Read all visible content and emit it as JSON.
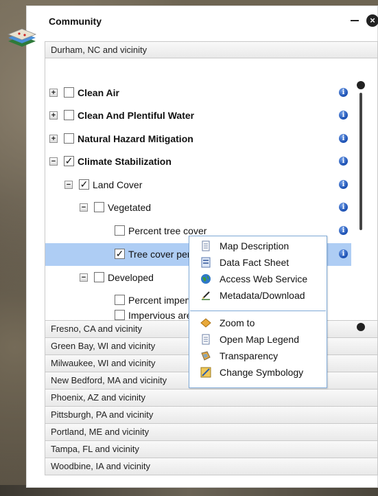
{
  "panel": {
    "title": "Community",
    "minimize_label": "_",
    "close_label": "×"
  },
  "communities": {
    "expanded": "Durham, NC and vicinity",
    "others": [
      "Fresno, CA and vicinity",
      "Green Bay, WI and vicinity",
      "Milwaukee, WI and vicinity",
      "New Bedford, MA and vicinity",
      "Phoenix, AZ and vicinity",
      "Pittsburgh, PA and vicinity",
      "Portland, ME and vicinity",
      "Tampa, FL and vicinity",
      "Woodbine, IA and vicinity"
    ]
  },
  "tree": [
    {
      "label": "Clean Air",
      "bold": true,
      "toggle": "+",
      "checked": false
    },
    {
      "label": "Clean And Plentiful Water",
      "bold": true,
      "toggle": "+",
      "checked": false
    },
    {
      "label": "Natural Hazard Mitigation",
      "bold": true,
      "toggle": "+",
      "checked": false
    },
    {
      "label": "Climate Stabilization",
      "bold": true,
      "toggle": "−",
      "checked": true
    },
    {
      "label": "Land Cover",
      "bold": false,
      "toggle": "−",
      "checked": true
    },
    {
      "label": "Vegetated",
      "bold": false,
      "toggle": "−",
      "checked": false
    },
    {
      "label": "Percent tree cover",
      "bold": false,
      "toggle": "",
      "checked": false
    },
    {
      "label": "Tree cover per capita (m2/person)",
      "bold": false,
      "toggle": "",
      "checked": true,
      "selected": true
    },
    {
      "label": "Developed",
      "bold": false,
      "toggle": "−",
      "checked": false
    },
    {
      "label": "Percent impervious",
      "bold": false,
      "toggle": "",
      "checked": false
    },
    {
      "label": "Impervious area p",
      "bold": false,
      "toggle": "",
      "checked": false
    }
  ],
  "info_label": "i",
  "check_mark": "✓",
  "context_menu": {
    "items": [
      {
        "label": "Map Description",
        "icon": "document-icon"
      },
      {
        "label": "Data Fact Sheet",
        "icon": "sheet-icon"
      },
      {
        "label": "Access Web Service",
        "icon": "globe-icon"
      },
      {
        "label": "Metadata/Download",
        "icon": "pen-icon"
      },
      {
        "label": "Zoom to",
        "icon": "zoom-icon"
      },
      {
        "label": "Open Map Legend",
        "icon": "legend-icon"
      },
      {
        "label": "Transparency",
        "icon": "transparency-icon"
      },
      {
        "label": "Change Symbology",
        "icon": "symbology-icon"
      }
    ]
  }
}
